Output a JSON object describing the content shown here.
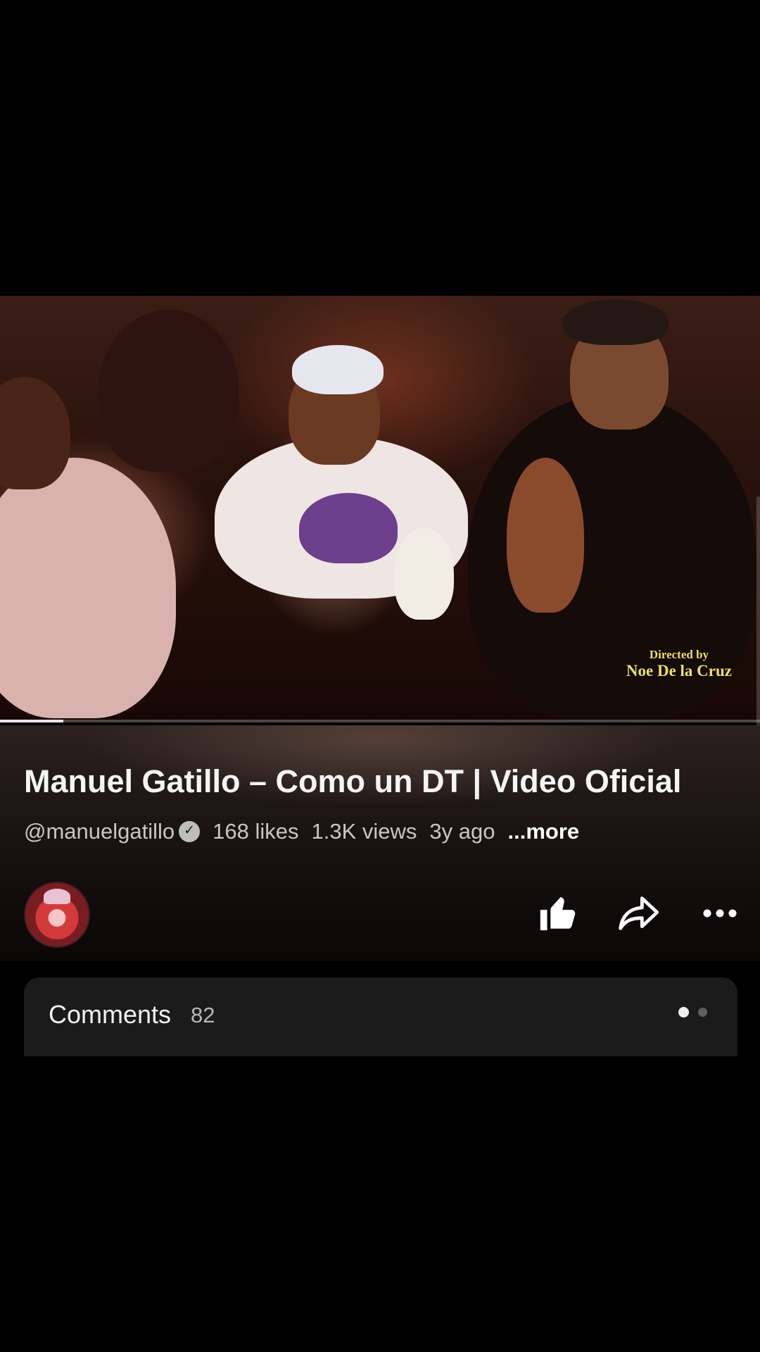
{
  "video": {
    "credit_line1": "Directed by",
    "credit_line2": "Noe  De la Cruz",
    "progress_fraction": 0.083
  },
  "info": {
    "title": "Manuel Gatillo – Como un DT | Video Oficial",
    "channel": "@manuelgatillo",
    "likes": "168 likes",
    "views": "1.3K views",
    "age": "3y ago",
    "more": "...more"
  },
  "actions": {
    "like_icon": "thumbs-up-icon",
    "share_icon": "share-arrow-icon",
    "more_icon": "more-dots-icon"
  },
  "comments": {
    "label": "Comments",
    "count": "82"
  },
  "colors": {
    "credit": "#f2e05a",
    "background": "#000000",
    "comments_bg": "#1c1b1b"
  }
}
